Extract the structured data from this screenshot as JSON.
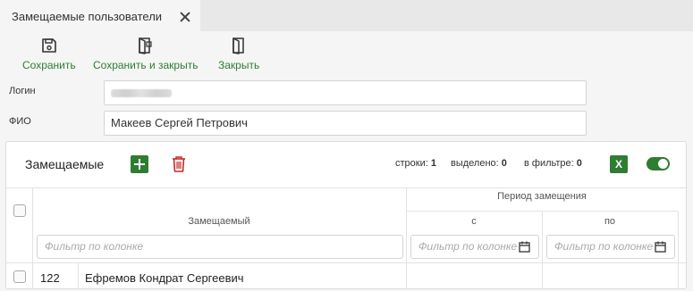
{
  "tab": {
    "title": "Замещаемые пользователи"
  },
  "toolbar": {
    "save": "Сохранить",
    "save_close": "Сохранить и закрыть",
    "close": "Закрыть"
  },
  "form": {
    "login_label": "Логин",
    "fio_label": "ФИО",
    "fio_value": "Макеев Сергей Петрович"
  },
  "panel": {
    "title": "Замещаемые",
    "rows_label": "строки:",
    "rows_value": "1",
    "selected_label": "выделено:",
    "selected_value": "0",
    "filtered_label": "в фильтре:",
    "filtered_value": "0",
    "excel_label": "X"
  },
  "grid": {
    "col_substituted": "Замещаемый",
    "col_period": "Период замещения",
    "col_from": "с",
    "col_to": "по",
    "filter_placeholder": "Фильтр по колонке",
    "filter_placeholder_short": "Фильтр по колонке",
    "rows": [
      {
        "id": "122",
        "name": "Ефремов Кондрат Сергеевич",
        "from": "",
        "to": ""
      }
    ]
  },
  "colors": {
    "accent": "#2e7d32",
    "danger": "#c62828"
  }
}
